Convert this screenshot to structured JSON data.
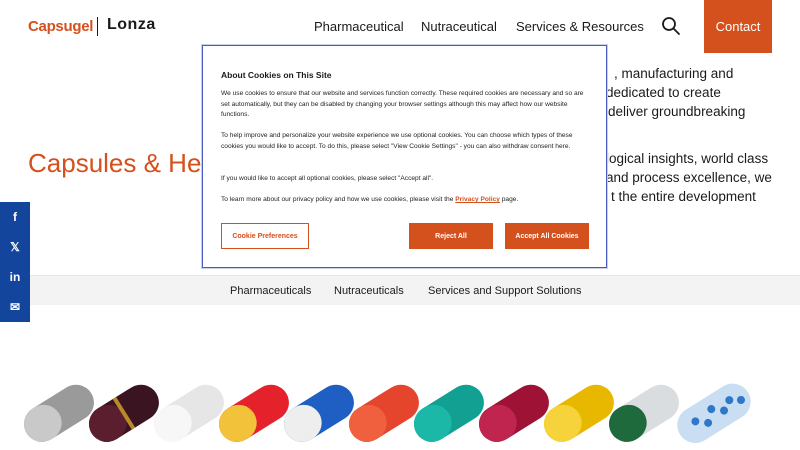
{
  "header": {
    "logo_capsugel": "Capsugel",
    "logo_lonza": "Lonza",
    "nav": [
      "Pharmaceutical",
      "Nutraceutical",
      "Services & Resources"
    ],
    "contact_label": "Contact"
  },
  "hero": {
    "title_visible": "Capsules & Hea",
    "lines": [
      ", manufacturing and",
      "dedicated to create",
      "deliver groundbreaking",
      "logical insights, world class",
      "and process excellence, we",
      "t the entire development"
    ]
  },
  "social": {
    "items": [
      "f",
      "𝕏",
      "in",
      "✉"
    ]
  },
  "subnav": {
    "items": [
      "Pharmaceuticals",
      "Nutraceuticals",
      "Services and Support Solutions"
    ]
  },
  "cookie_modal": {
    "title": "About Cookies on This Site",
    "p1": "We use cookies to ensure that our website and services function correctly. These required cookies are necessary and so are set automatically, but they can be disabled by changing your browser settings although this may affect how our website functions.",
    "p2": "To help improve and personalize your website experience we use optional cookies. You can choose which types of these cookies you would like to accept. To do this, please select \"View Cookie Settings\" - you can also withdraw consent here.",
    "p3": "If you would like to accept all optional cookies, please select \"Accept all\".",
    "p4_prefix": "To learn more about our privacy policy and how we use cookies, please visit the ",
    "p4_link": "Privacy Policy",
    "p4_suffix": " page.",
    "btn_prefs": "Cookie Preferences",
    "btn_reject": "Reject All",
    "btn_accept": "Accept All Cookies"
  },
  "colors": {
    "brand_orange": "#d4501d",
    "social_blue": "#14459c"
  }
}
